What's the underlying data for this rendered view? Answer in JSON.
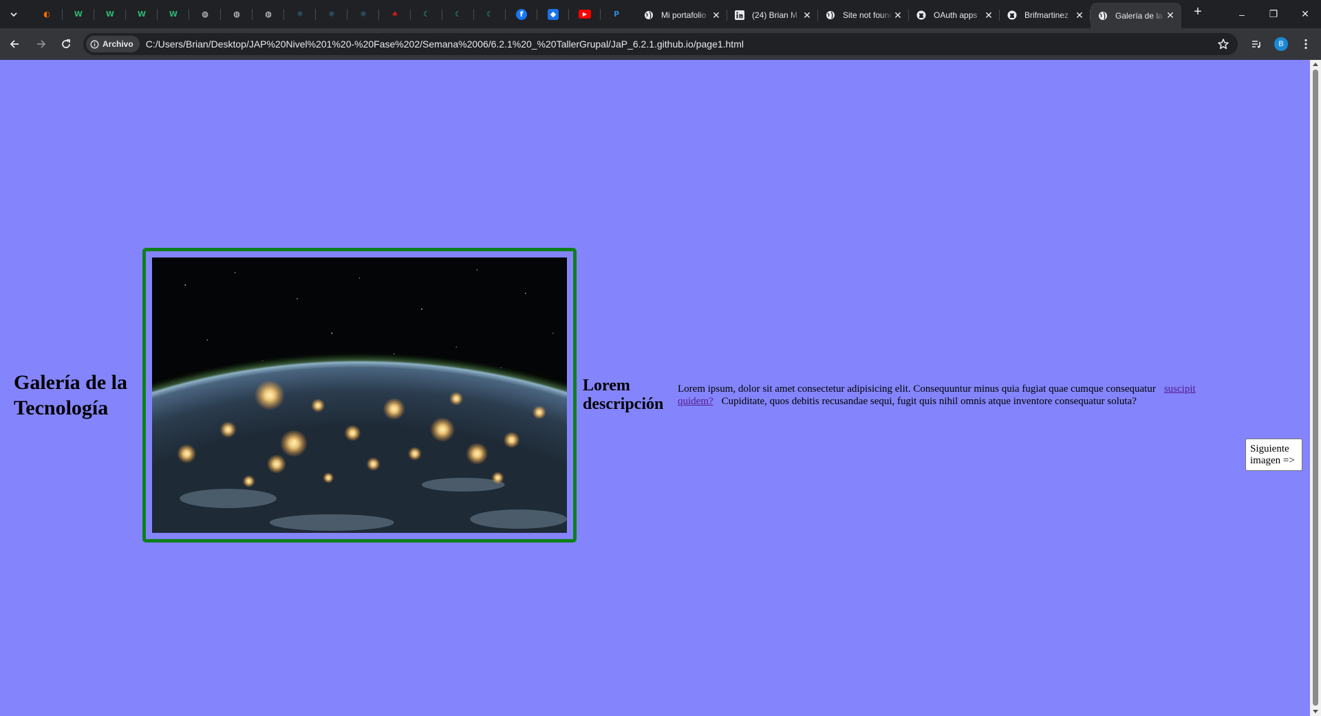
{
  "browser": {
    "pinned_tabs": [
      {
        "icon": "flame-icon",
        "color": "#ff6d00",
        "glyph": "◐"
      },
      {
        "icon": "w-logo-icon",
        "color": "#2bb673",
        "glyph": "W"
      },
      {
        "icon": "w-logo-icon",
        "color": "#2bb673",
        "glyph": "W"
      },
      {
        "icon": "w-logo-icon",
        "color": "#2bb673",
        "glyph": "W"
      },
      {
        "icon": "w-logo-icon",
        "color": "#2bb673",
        "glyph": "W"
      },
      {
        "icon": "globe-icon",
        "color": "#e8eaed",
        "glyph": "◍"
      },
      {
        "icon": "globe-icon",
        "color": "#e8eaed",
        "glyph": "◍"
      },
      {
        "icon": "globe-icon",
        "color": "#e8eaed",
        "glyph": "◍"
      },
      {
        "icon": "react-icon",
        "color": "#3b9bdb",
        "glyph": "⚛"
      },
      {
        "icon": "react-icon",
        "color": "#3b9bdb",
        "glyph": "⚛"
      },
      {
        "icon": "react-icon",
        "color": "#3b9bdb",
        "glyph": "⚛"
      },
      {
        "icon": "red-leaf-icon",
        "color": "#d01818",
        "glyph": "♠"
      },
      {
        "icon": "crescent-icon",
        "color": "#1fb7a6",
        "glyph": "☾"
      },
      {
        "icon": "crescent-icon",
        "color": "#1fb7a6",
        "glyph": "☾"
      },
      {
        "icon": "crescent-icon",
        "color": "#1fb7a6",
        "glyph": "☾"
      },
      {
        "icon": "facebook-icon",
        "color": "#1877f2",
        "glyph": "f"
      },
      {
        "icon": "dropbox-icon",
        "color": "#1a73e8",
        "glyph": "◆"
      },
      {
        "icon": "youtube-icon",
        "color": "#ff0000",
        "glyph": "▶"
      },
      {
        "icon": "paypal-icon",
        "color": "#2e8bd6",
        "glyph": "P"
      }
    ],
    "tabs": [
      {
        "title": "Mi portafolio",
        "icon": "globe-icon",
        "active": false
      },
      {
        "title": "(24) Brian M",
        "icon": "linkedin-icon",
        "active": false
      },
      {
        "title": "Site not found",
        "icon": "globe-icon",
        "active": false
      },
      {
        "title": "OAuth apps",
        "icon": "github-icon",
        "active": false
      },
      {
        "title": "Brifmartinez",
        "icon": "github-icon",
        "active": false
      },
      {
        "title": "Galería de la Tecnología",
        "icon": "globe-icon",
        "active": true
      }
    ],
    "tab_close_glyph": "✕",
    "new_tab_glyph": "+",
    "window": {
      "minimize": "–",
      "restore": "❐",
      "close": "✕"
    },
    "security_chip": "Archivo",
    "url": "C:/Users/Brian/Desktop/JAP%20Nivel%201%20-%20Fase%202/Semana%2006/6.2.1%20_%20TallerGrupal/JaP_6.2.1.github.io/page1.html",
    "profile_initial": "B"
  },
  "page": {
    "title": "Galería de la Tecnología",
    "image_alt": "Earth at night from space",
    "description_title": "Lorem descripción",
    "description_before": "Lorem ipsum, dolor sit amet consectetur adipisicing elit. Consequuntur minus quia fugiat quae cumque consequatur",
    "description_link": "suscipit quidem?",
    "description_after": "Cupiditate, quos debitis recusandae sequi, fugit quis nihil omnis atque inventore consequatur soluta?",
    "next_button": "Siguiente imagen =>"
  }
}
